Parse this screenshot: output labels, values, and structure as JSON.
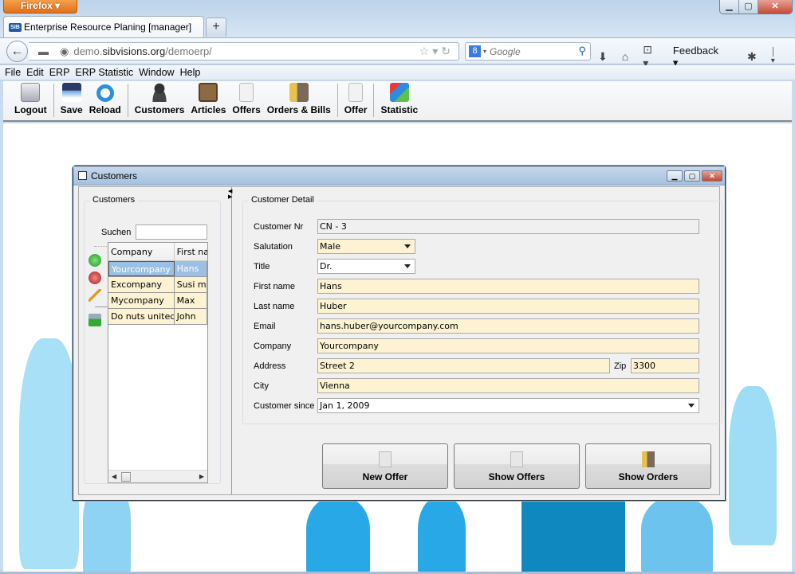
{
  "browser": {
    "app_button": "Firefox",
    "window_controls": {
      "minimize": "minimize-icon",
      "maximize": "maximize-icon",
      "close": "close-icon"
    },
    "tab": {
      "favicon": "SIB",
      "title": "Enterprise Resource Planing [manager]"
    },
    "new_tab": "+",
    "url": {
      "prefix": "demo.",
      "host": "sibvisions.org",
      "path": "/demoerp/"
    },
    "search": {
      "engine": "8",
      "placeholder": "Google"
    },
    "feedback_label": "Feedback"
  },
  "menu": [
    "File",
    "Edit",
    "ERP",
    "ERP Statistic",
    "Window",
    "Help"
  ],
  "toolbar": [
    {
      "label": "Logout",
      "icon": "lock-icon"
    },
    {
      "label": "Save",
      "icon": "floppy-icon"
    },
    {
      "label": "Reload",
      "icon": "reload-icon"
    },
    {
      "label": "Customers",
      "icon": "person-icon"
    },
    {
      "label": "Articles",
      "icon": "boxes-icon"
    },
    {
      "label": "Offers",
      "icon": "document-icon"
    },
    {
      "label": "Orders & Bills",
      "icon": "truck-icon"
    },
    {
      "label": "Offer",
      "icon": "document-icon"
    },
    {
      "label": "Statistic",
      "icon": "chart-icon"
    }
  ],
  "window": {
    "title": "Customers",
    "left": {
      "group_title": "Customers",
      "search_label": "Suchen",
      "search_value": "",
      "table": {
        "columns": [
          "Company",
          "First na"
        ],
        "rows": [
          {
            "company": "Yourcompany",
            "first": "Hans",
            "selected": true
          },
          {
            "company": "Excompany",
            "first": "Susi mo",
            "selected": false
          },
          {
            "company": "Mycompany",
            "first": "Max",
            "selected": false
          },
          {
            "company": "Do nuts united",
            "first": "John",
            "selected": false
          }
        ]
      }
    },
    "detail": {
      "group_title": "Customer Detail",
      "fields": {
        "customer_nr": {
          "label": "Customer Nr",
          "value": "CN - 3"
        },
        "salutation": {
          "label": "Salutation",
          "value": "Male"
        },
        "title": {
          "label": "Title",
          "value": "Dr."
        },
        "first_name": {
          "label": "First name",
          "value": "Hans"
        },
        "last_name": {
          "label": "Last name",
          "value": "Huber"
        },
        "email": {
          "label": "Email",
          "value": "hans.huber@yourcompany.com"
        },
        "company": {
          "label": "Company",
          "value": "Yourcompany"
        },
        "address": {
          "label": "Address",
          "value": "Street 2"
        },
        "zip": {
          "label": "Zip",
          "value": "3300"
        },
        "city": {
          "label": "City",
          "value": "Vienna"
        },
        "customer_since": {
          "label": "Customer since",
          "value": "Jan 1, 2009"
        }
      },
      "buttons": {
        "new_offer": "New Offer",
        "show_offers": "Show Offers",
        "show_orders": "Show Orders"
      }
    }
  }
}
